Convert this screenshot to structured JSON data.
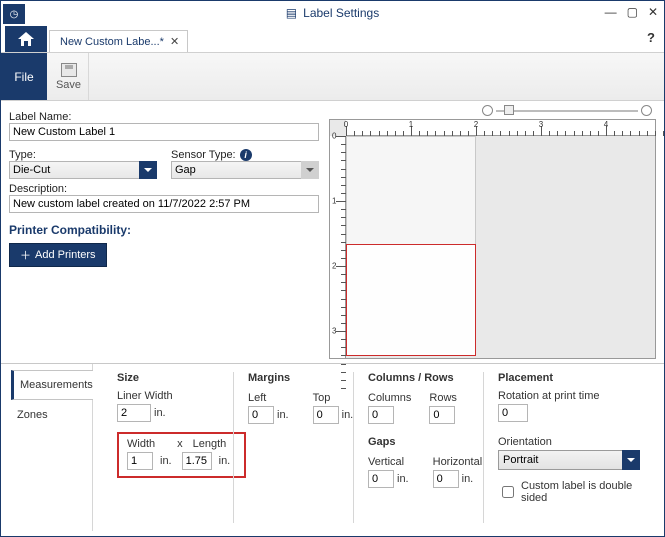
{
  "window": {
    "title": "Label Settings"
  },
  "tabs": {
    "document_title": "New Custom Labe...*"
  },
  "ribbon": {
    "file": "File",
    "save": "Save"
  },
  "form": {
    "label_name_label": "Label Name:",
    "label_name": "New Custom Label 1",
    "type_label": "Type:",
    "type": "Die-Cut",
    "sensor_label": "Sensor Type:",
    "sensor": "Gap",
    "description_label": "Description:",
    "description": "New custom label created on 11/7/2022 2:57 PM",
    "compat_header": "Printer Compatibility:",
    "add_printers": "Add Printers"
  },
  "ruler": {
    "h": [
      "0",
      "1",
      "2",
      "3",
      "4"
    ],
    "v": [
      "0",
      "1",
      "2",
      "3"
    ]
  },
  "side_tabs": {
    "measurements": "Measurements",
    "zones": "Zones"
  },
  "size": {
    "header": "Size",
    "liner_width_label": "Liner Width",
    "liner_width": "2",
    "width_label": "Width",
    "x": "x",
    "length_label": "Length",
    "width": "1",
    "length": "1.75",
    "unit": "in."
  },
  "margins": {
    "header": "Margins",
    "left_label": "Left",
    "left": "0",
    "top_label": "Top",
    "top": "0",
    "unit": "in."
  },
  "cols": {
    "header": "Columns / Rows",
    "columns_label": "Columns",
    "columns": "0",
    "rows_label": "Rows",
    "rows": "0",
    "gaps_header": "Gaps",
    "vertical_label": "Vertical",
    "vertical": "0",
    "horizontal_label": "Horizontal",
    "horizontal": "0",
    "unit": "in."
  },
  "placement": {
    "header": "Placement",
    "rotation_label": "Rotation at print time",
    "rotation": "0",
    "orientation_label": "Orientation",
    "orientation": "Portrait",
    "double_sided_label": "Custom label is double sided"
  },
  "chart_data": {
    "type": "table",
    "note": "Label preview canvas shows a liner 2in wide with a label 1in x 1.75in outlined in red on a ruler grid."
  }
}
